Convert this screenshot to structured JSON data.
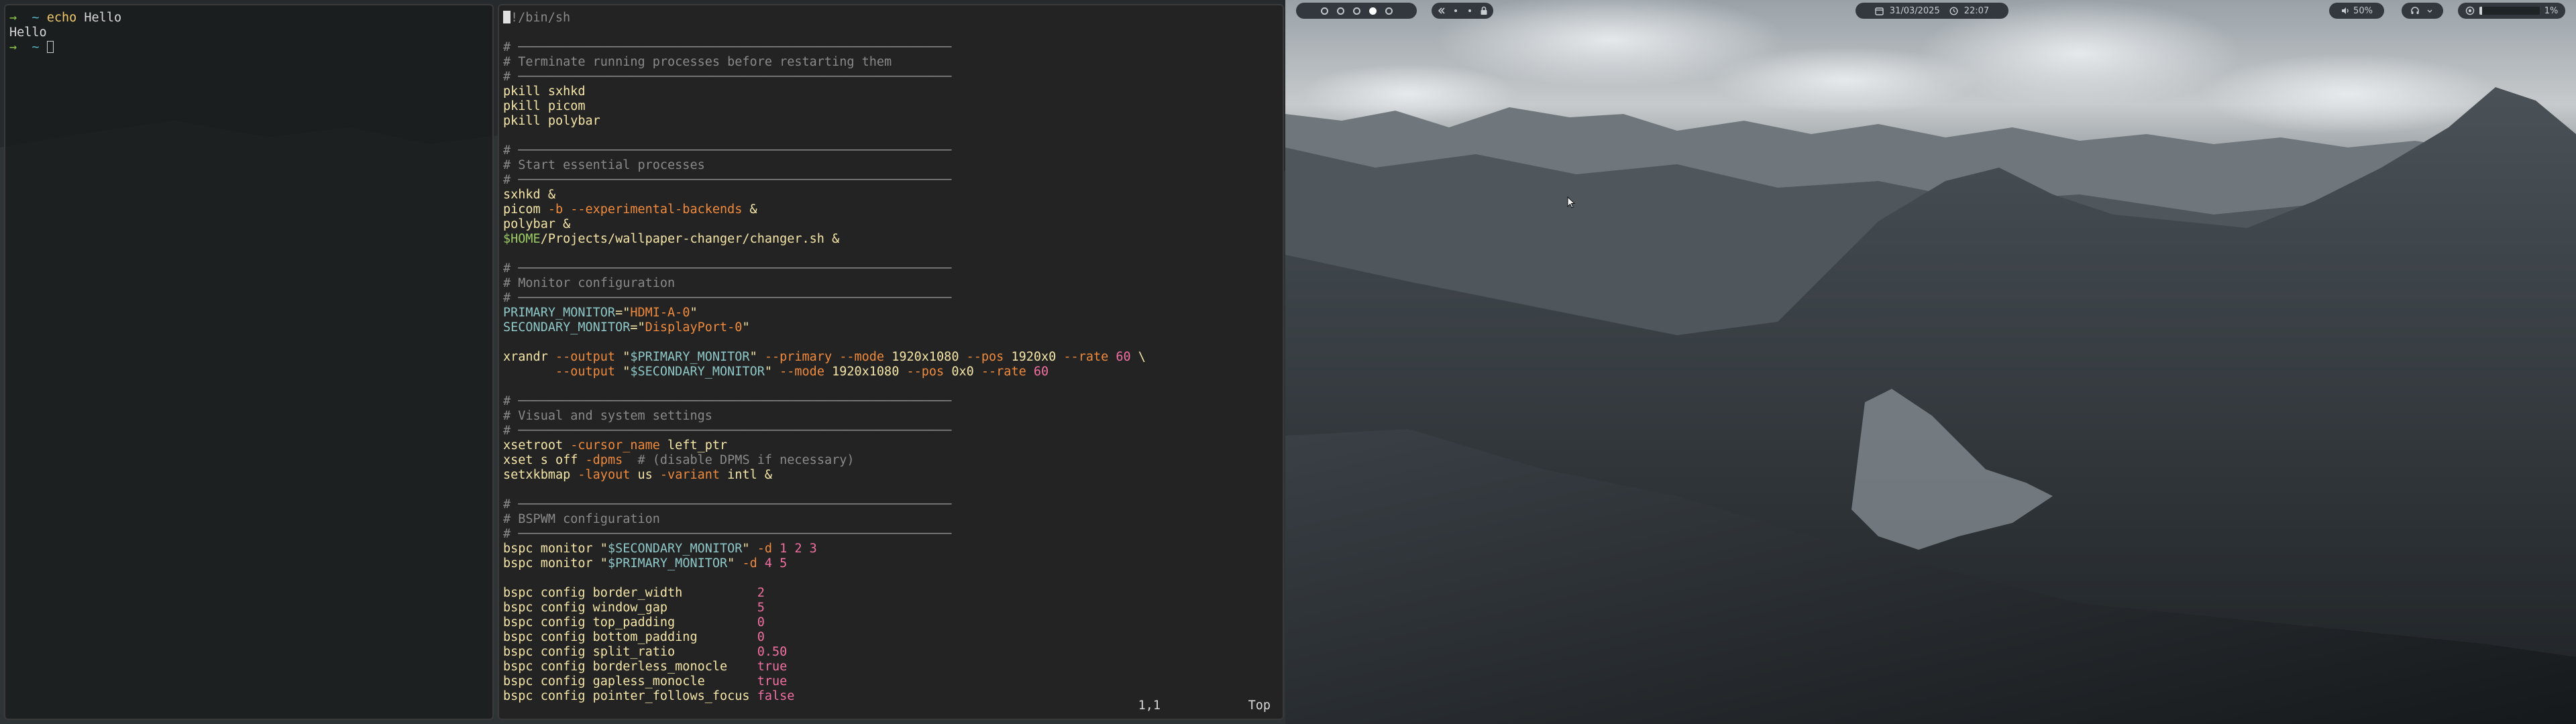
{
  "left_terminal": {
    "lines": [
      [
        {
          "t": "→",
          "c": "prompt"
        },
        {
          "t": "  ~ ",
          "c": "tilde"
        },
        {
          "t": "echo",
          "c": "cmd"
        },
        {
          "t": " Hello",
          "c": "def"
        }
      ],
      [
        {
          "t": "Hello",
          "c": "def"
        }
      ],
      [
        {
          "t": "→",
          "c": "prompt"
        },
        {
          "t": "  ~ ",
          "c": "tilde"
        },
        {
          "cursor": "box"
        }
      ]
    ]
  },
  "editor": {
    "lines": [
      [
        {
          "cursor": "block"
        },
        {
          "t": "!/bin/sh",
          "c": "cmt"
        }
      ],
      [
        {
          "t": "",
          "c": "def"
        }
      ],
      [
        {
          "t": "# ──────────────────────────────────────────────────────────",
          "c": "cmt"
        }
      ],
      [
        {
          "t": "# Terminate running processes before restarting them",
          "c": "cmt"
        }
      ],
      [
        {
          "t": "# ──────────────────────────────────────────────────────────",
          "c": "cmt"
        }
      ],
      [
        {
          "t": "pkill sxhkd",
          "c": "kw"
        }
      ],
      [
        {
          "t": "pkill picom",
          "c": "kw"
        }
      ],
      [
        {
          "t": "pkill polybar",
          "c": "kw"
        }
      ],
      [
        {
          "t": "",
          "c": "def"
        }
      ],
      [
        {
          "t": "# ──────────────────────────────────────────────────────────",
          "c": "cmt"
        }
      ],
      [
        {
          "t": "# Start essential processes",
          "c": "cmt"
        }
      ],
      [
        {
          "t": "# ──────────────────────────────────────────────────────────",
          "c": "cmt"
        }
      ],
      [
        {
          "t": "sxhkd &",
          "c": "kw"
        }
      ],
      [
        {
          "t": "picom ",
          "c": "kw"
        },
        {
          "t": "-b --experimental-backends",
          "c": "flag"
        },
        {
          "t": " &",
          "c": "kw"
        }
      ],
      [
        {
          "t": "polybar &",
          "c": "kw"
        }
      ],
      [
        {
          "t": "$HOME",
          "c": "env"
        },
        {
          "t": "/Projects/wallpaper-changer/changer.sh &",
          "c": "kw"
        }
      ],
      [
        {
          "t": "",
          "c": "def"
        }
      ],
      [
        {
          "t": "# ──────────────────────────────────────────────────────────",
          "c": "cmt"
        }
      ],
      [
        {
          "t": "# Monitor configuration",
          "c": "cmt"
        }
      ],
      [
        {
          "t": "# ──────────────────────────────────────────────────────────",
          "c": "cmt"
        }
      ],
      [
        {
          "t": "PRIMARY_MONITOR",
          "c": "var"
        },
        {
          "t": "=\"",
          "c": "kw"
        },
        {
          "t": "HDMI-A-0",
          "c": "flag"
        },
        {
          "t": "\"",
          "c": "kw"
        }
      ],
      [
        {
          "t": "SECONDARY_MONITOR",
          "c": "var"
        },
        {
          "t": "=\"",
          "c": "kw"
        },
        {
          "t": "DisplayPort-0",
          "c": "flag"
        },
        {
          "t": "\"",
          "c": "kw"
        }
      ],
      [
        {
          "t": "",
          "c": "def"
        }
      ],
      [
        {
          "t": "xrandr ",
          "c": "kw"
        },
        {
          "t": "--output",
          "c": "flag"
        },
        {
          "t": " \"",
          "c": "kw"
        },
        {
          "t": "$PRIMARY_MONITOR",
          "c": "var"
        },
        {
          "t": "\" ",
          "c": "kw"
        },
        {
          "t": "--primary --mode",
          "c": "flag"
        },
        {
          "t": " 1920x1080 ",
          "c": "kw"
        },
        {
          "t": "--pos",
          "c": "flag"
        },
        {
          "t": " 1920x0 ",
          "c": "kw"
        },
        {
          "t": "--rate",
          "c": "flag"
        },
        {
          "t": " ",
          "c": "kw"
        },
        {
          "t": "60",
          "c": "num"
        },
        {
          "t": " \\",
          "c": "kw"
        }
      ],
      [
        {
          "t": "       ",
          "c": "kw"
        },
        {
          "t": "--output",
          "c": "flag"
        },
        {
          "t": " \"",
          "c": "kw"
        },
        {
          "t": "$SECONDARY_MONITOR",
          "c": "var"
        },
        {
          "t": "\" ",
          "c": "kw"
        },
        {
          "t": "--mode",
          "c": "flag"
        },
        {
          "t": " 1920x1080 ",
          "c": "kw"
        },
        {
          "t": "--pos",
          "c": "flag"
        },
        {
          "t": " 0x0 ",
          "c": "kw"
        },
        {
          "t": "--rate",
          "c": "flag"
        },
        {
          "t": " ",
          "c": "kw"
        },
        {
          "t": "60",
          "c": "num"
        }
      ],
      [
        {
          "t": "",
          "c": "def"
        }
      ],
      [
        {
          "t": "# ──────────────────────────────────────────────────────────",
          "c": "cmt"
        }
      ],
      [
        {
          "t": "# Visual and system settings",
          "c": "cmt"
        }
      ],
      [
        {
          "t": "# ──────────────────────────────────────────────────────────",
          "c": "cmt"
        }
      ],
      [
        {
          "t": "xsetroot ",
          "c": "kw"
        },
        {
          "t": "-cursor_name",
          "c": "flag"
        },
        {
          "t": " left_ptr",
          "c": "kw"
        }
      ],
      [
        {
          "t": "xset s off ",
          "c": "kw"
        },
        {
          "t": "-dpms",
          "c": "flag"
        },
        {
          "t": "  # (disable DPMS if necessary)",
          "c": "cmt"
        }
      ],
      [
        {
          "t": "setxkbmap ",
          "c": "kw"
        },
        {
          "t": "-layout",
          "c": "flag"
        },
        {
          "t": " us ",
          "c": "kw"
        },
        {
          "t": "-variant",
          "c": "flag"
        },
        {
          "t": " intl &",
          "c": "kw"
        }
      ],
      [
        {
          "t": "",
          "c": "def"
        }
      ],
      [
        {
          "t": "# ──────────────────────────────────────────────────────────",
          "c": "cmt"
        }
      ],
      [
        {
          "t": "# BSPWM configuration",
          "c": "cmt"
        }
      ],
      [
        {
          "t": "# ──────────────────────────────────────────────────────────",
          "c": "cmt"
        }
      ],
      [
        {
          "t": "bspc monitor \"",
          "c": "kw"
        },
        {
          "t": "$SECONDARY_MONITOR",
          "c": "var"
        },
        {
          "t": "\" ",
          "c": "kw"
        },
        {
          "t": "-d",
          "c": "flag"
        },
        {
          "t": " ",
          "c": "kw"
        },
        {
          "t": "1 2 3",
          "c": "num"
        }
      ],
      [
        {
          "t": "bspc monitor \"",
          "c": "kw"
        },
        {
          "t": "$PRIMARY_MONITOR",
          "c": "var"
        },
        {
          "t": "\" ",
          "c": "kw"
        },
        {
          "t": "-d",
          "c": "flag"
        },
        {
          "t": " ",
          "c": "kw"
        },
        {
          "t": "4 5",
          "c": "num"
        }
      ],
      [
        {
          "t": "",
          "c": "def"
        }
      ],
      [
        {
          "t": "bspc config border_width          ",
          "c": "kw"
        },
        {
          "t": "2",
          "c": "num"
        }
      ],
      [
        {
          "t": "bspc config window_gap            ",
          "c": "kw"
        },
        {
          "t": "5",
          "c": "num"
        }
      ],
      [
        {
          "t": "bspc config top_padding           ",
          "c": "kw"
        },
        {
          "t": "0",
          "c": "num"
        }
      ],
      [
        {
          "t": "bspc config bottom_padding        ",
          "c": "kw"
        },
        {
          "t": "0",
          "c": "num"
        }
      ],
      [
        {
          "t": "bspc config split_ratio           ",
          "c": "kw"
        },
        {
          "t": "0.50",
          "c": "num"
        }
      ],
      [
        {
          "t": "bspc config borderless_monocle    ",
          "c": "kw"
        },
        {
          "t": "true",
          "c": "num"
        }
      ],
      [
        {
          "t": "bspc config gapless_monocle       ",
          "c": "kw"
        },
        {
          "t": "true",
          "c": "num"
        }
      ],
      [
        {
          "t": "bspc config pointer_follows_focus ",
          "c": "kw"
        },
        {
          "t": "false",
          "c": "num"
        }
      ]
    ],
    "status": {
      "position": "1,1",
      "scroll": "Top"
    }
  },
  "bar": {
    "date": "31/03/2025",
    "time": "22:07",
    "volume": "50%",
    "brightness": "1%",
    "workspace_count": 5,
    "active_workspace": 4,
    "volume_level": 0.05
  },
  "colors": {
    "prompt": "#8bc34a",
    "comment": "#8a8a8a",
    "flag": "#f08a3c",
    "number": "#f06fa0",
    "bar_bg": "#32383d"
  },
  "icons": {
    "clock": "clock-icon",
    "calendar": "calendar-icon",
    "speaker": "speaker-icon",
    "headphones": "headphones-icon",
    "brightness": "brightness-icon",
    "lock": "lock-icon"
  }
}
